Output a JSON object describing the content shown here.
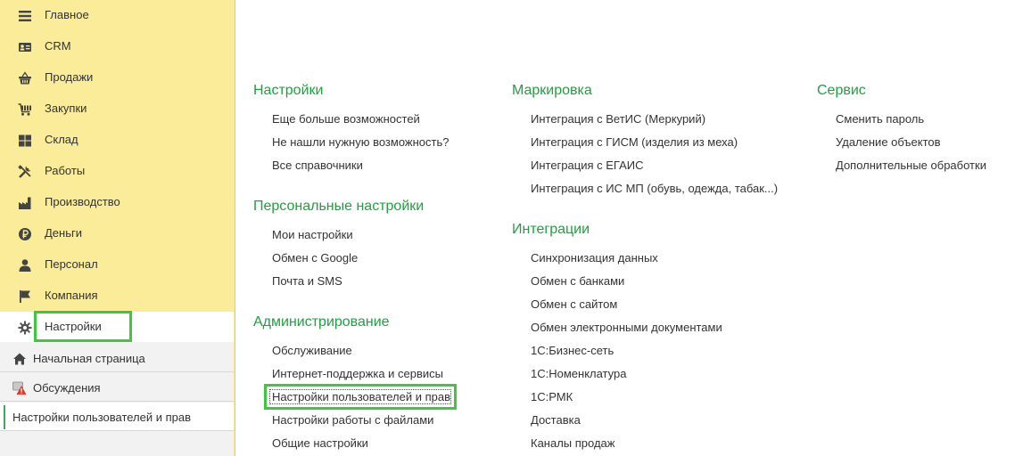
{
  "sidebar": {
    "items": [
      {
        "label": "Главное",
        "icon": "menu-lines-icon"
      },
      {
        "label": "CRM",
        "icon": "contact-card-icon"
      },
      {
        "label": "Продажи",
        "icon": "basket-icon"
      },
      {
        "label": "Закупки",
        "icon": "cart-icon"
      },
      {
        "label": "Склад",
        "icon": "warehouse-grid-icon"
      },
      {
        "label": "Работы",
        "icon": "tools-icon"
      },
      {
        "label": "Производство",
        "icon": "factory-icon"
      },
      {
        "label": "Деньги",
        "icon": "ruble-coin-icon"
      },
      {
        "label": "Персонал",
        "icon": "person-icon"
      },
      {
        "label": "Компания",
        "icon": "flag-icon"
      },
      {
        "label": "Настройки",
        "icon": "gear-icon"
      }
    ],
    "bottom": {
      "home": {
        "label": "Начальная страница"
      },
      "discussions": {
        "label": "Обсуждения"
      },
      "open_window": {
        "label": "Настройки пользователей и прав"
      }
    }
  },
  "main": {
    "col1": {
      "settings": {
        "title": "Настройки",
        "links": [
          "Еще больше возможностей",
          "Не нашли нужную возможность?",
          "Все справочники"
        ]
      },
      "personal": {
        "title": "Персональные настройки",
        "links": [
          "Мои настройки",
          "Обмен с Google",
          "Почта и SMS"
        ]
      },
      "admin": {
        "title": "Администрирование",
        "links": [
          "Обслуживание",
          "Интернет-поддержка и сервисы",
          "Настройки пользователей и прав",
          "Настройки работы с файлами",
          "Общие настройки"
        ]
      }
    },
    "col2": {
      "marking": {
        "title": "Маркировка",
        "links": [
          "Интеграция с ВетИС (Меркурий)",
          "Интеграция с ГИСМ (изделия из меха)",
          "Интеграция с ЕГАИС",
          "Интеграция с ИС МП (обувь, одежда, табак...)"
        ]
      },
      "integrations": {
        "title": "Интеграции",
        "links": [
          "Синхронизация данных",
          "Обмен с банками",
          "Обмен с сайтом",
          "Обмен электронными документами",
          "1С:Бизнес-сеть",
          "1С:Номенклатура",
          "1С:РМК",
          "Доставка",
          "Каналы продаж"
        ]
      }
    },
    "col3": {
      "service": {
        "title": "Сервис",
        "links": [
          "Сменить пароль",
          "Удаление объектов",
          "Дополнительные обработки"
        ]
      }
    }
  },
  "colors": {
    "sidebar_bg": "#fbec9a",
    "section_title": "#20a040",
    "highlight_box": "#3ec83e"
  }
}
